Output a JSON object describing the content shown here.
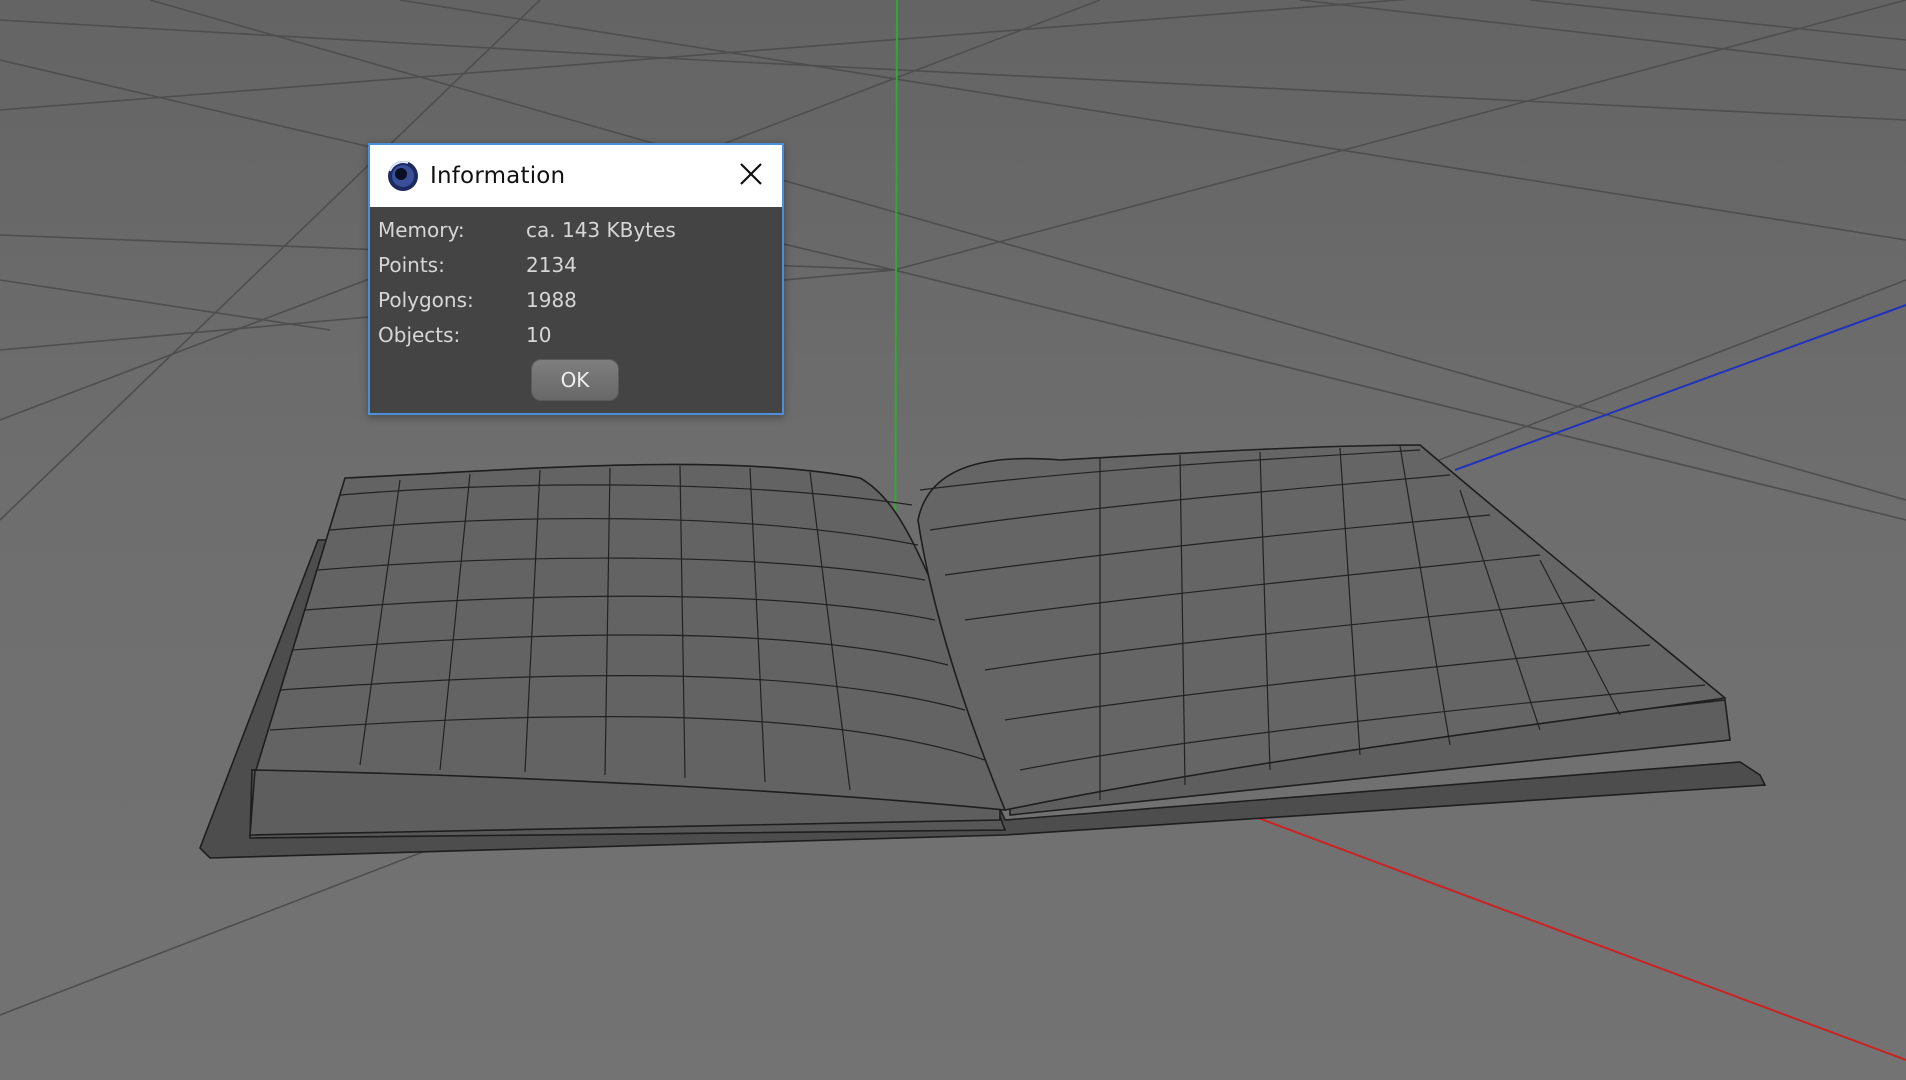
{
  "dialog": {
    "title": "Information",
    "app_icon": "cinema4d-icon",
    "close_icon": "close-icon",
    "rows": [
      {
        "label": "Memory:",
        "value": "ca. 143 KBytes"
      },
      {
        "label": "Points:",
        "value": "2134"
      },
      {
        "label": "Polygons:",
        "value": "1988"
      },
      {
        "label": "Objects:",
        "value": "10"
      }
    ],
    "ok_label": "OK"
  },
  "viewport": {
    "axis_colors": {
      "y_axis": "#2faa2f",
      "x_axis": "#cc2222",
      "z_axis": "#2233bb"
    },
    "model": "open-book-wireframe"
  }
}
